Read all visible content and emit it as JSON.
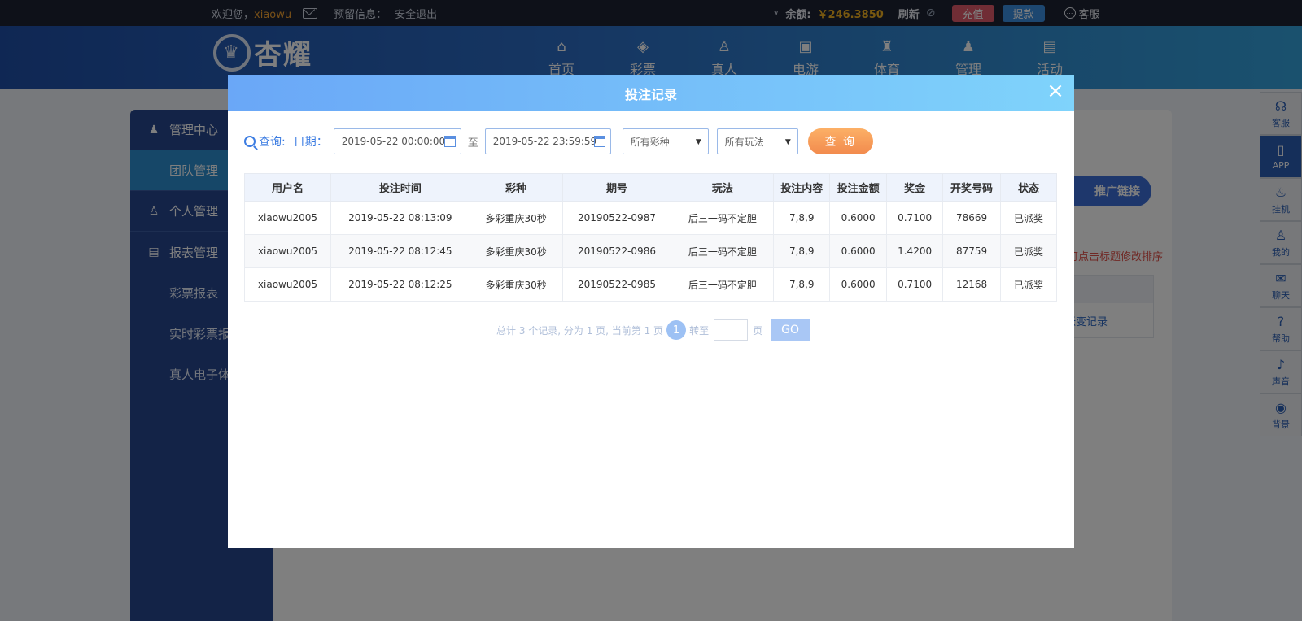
{
  "topbar": {
    "welcome": "欢迎您，",
    "username": "xiaowu",
    "reserved_label": "预留信息：",
    "logout": "安全退出",
    "balance_label": "余额:",
    "balance_value": "￥246.3850",
    "refresh": "刷新",
    "recharge": "充值",
    "withdraw": "提款",
    "service": "客服"
  },
  "header": {
    "logo_text": "杏耀",
    "nav": [
      {
        "label": "首页",
        "icon": "home-icon",
        "glyph": "⌂"
      },
      {
        "label": "彩票",
        "icon": "ticket-icon",
        "glyph": "◈"
      },
      {
        "label": "真人",
        "icon": "person-icon",
        "glyph": "♙"
      },
      {
        "label": "电游",
        "icon": "slot-machine-icon",
        "glyph": "▣"
      },
      {
        "label": "体育",
        "icon": "trophy-icon",
        "glyph": "♜"
      },
      {
        "label": "管理",
        "icon": "users-icon",
        "glyph": "♟"
      },
      {
        "label": "活动",
        "icon": "gift-icon",
        "glyph": "▤"
      }
    ]
  },
  "sidebar": {
    "items": [
      {
        "label": "管理中心",
        "icon": "users-icon"
      },
      {
        "label": "团队管理"
      },
      {
        "label": "个人管理",
        "icon": "person-icon"
      },
      {
        "label": "报表管理",
        "icon": "report-icon"
      },
      {
        "label": "彩票报表"
      },
      {
        "label": "实时彩票报"
      },
      {
        "label": "真人电子体"
      }
    ]
  },
  "main": {
    "promo_button": "推广链接",
    "hint": "可点击标题修改排序",
    "side_link": "帐变记录"
  },
  "dock": [
    {
      "label": "客服",
      "icon": "headset-icon",
      "glyph": "☊"
    },
    {
      "label": "APP",
      "icon": "phone-icon",
      "glyph": "▯"
    },
    {
      "label": "挂机",
      "icon": "bag-icon",
      "glyph": "♨"
    },
    {
      "label": "我的",
      "icon": "user-icon",
      "glyph": "♙"
    },
    {
      "label": "聊天",
      "icon": "chat-icon",
      "glyph": "✉"
    },
    {
      "label": "帮助",
      "icon": "help-icon",
      "glyph": "?"
    },
    {
      "label": "声音",
      "icon": "speaker-icon",
      "glyph": "♪"
    },
    {
      "label": "背景",
      "icon": "palette-icon",
      "glyph": "◉"
    }
  ],
  "modal": {
    "title": "投注记录",
    "close": "×",
    "query_label": "查询:",
    "date_label": "日期：",
    "start_date": "2019-05-22 00:00:00",
    "to_label": "至",
    "end_date": "2019-05-22 23:59:59",
    "lottery_select": "所有彩种",
    "play_select": "所有玩法",
    "query_button": "查 询",
    "columns": [
      "用户名",
      "投注时间",
      "彩种",
      "期号",
      "玩法",
      "投注内容",
      "投注金额",
      "奖金",
      "开奖号码",
      "状态"
    ],
    "rows": [
      [
        "xiaowu2005",
        "2019-05-22 08:13:09",
        "多彩重庆30秒",
        "20190522-0987",
        "后三一码不定胆",
        "7,8,9",
        "0.6000",
        "0.7100",
        "78669",
        "已派奖"
      ],
      [
        "xiaowu2005",
        "2019-05-22 08:12:45",
        "多彩重庆30秒",
        "20190522-0986",
        "后三一码不定胆",
        "7,8,9",
        "0.6000",
        "1.4200",
        "87759",
        "已派奖"
      ],
      [
        "xiaowu2005",
        "2019-05-22 08:12:25",
        "多彩重庆30秒",
        "20190522-0985",
        "后三一码不定胆",
        "7,8,9",
        "0.6000",
        "0.7100",
        "12168",
        "已派奖"
      ]
    ],
    "pager": {
      "summary": "总计 3 个记录, 分为 1 页, 当前第 1 页",
      "current": "1",
      "goto_label": "转至",
      "page_label": "页",
      "go": "GO"
    }
  }
}
